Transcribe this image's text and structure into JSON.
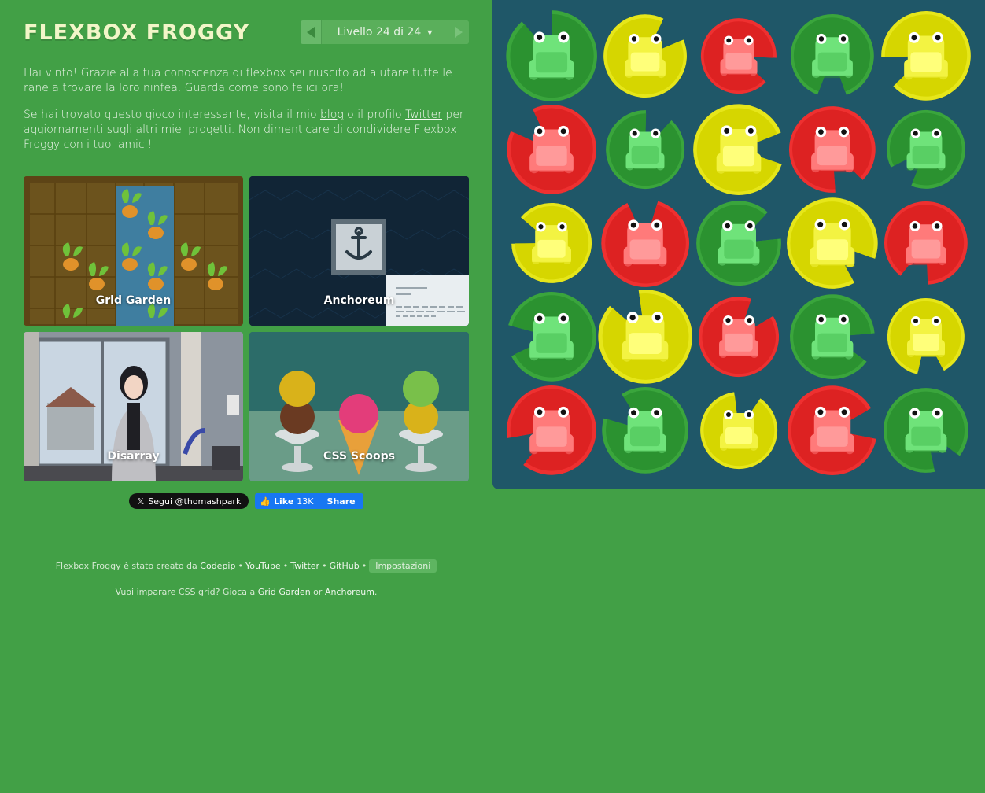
{
  "header": {
    "title": "FLEXBOX FROGGY",
    "level_text": "Livello 24 di 24"
  },
  "intro": {
    "win_text": "Hai vinto! Grazie alla tua conoscenza di flexbox sei riuscito ad aiutare tutte le rane a trovare la loro ninfea. Guarda come sono felici ora!",
    "follow_pre": "Se hai trovato questo gioco interessante, visita il mio ",
    "blog_link": "blog",
    "follow_mid": " o il profilo ",
    "twitter_link": "Twitter",
    "follow_post": " per aggiornamenti sugli altri miei progetti. Non dimenticare di condividere Flexbox Froggy con i tuoi amici!"
  },
  "games": [
    {
      "label": "Grid Garden"
    },
    {
      "label": "Anchoreum"
    },
    {
      "label": "Disarray"
    },
    {
      "label": "CSS Scoops"
    }
  ],
  "social": {
    "tweet_label": "Segui @thomashpark",
    "fb_like": "Like",
    "fb_count": "13K",
    "fb_share": "Share"
  },
  "credits": {
    "created_by": "Flexbox Froggy è stato creato da",
    "codepip": "Codepip",
    "youtube": "YouTube",
    "twitter": "Twitter",
    "github": "GitHub",
    "settings": "Impostazioni",
    "learn_pre": "Vuoi imparare CSS grid? Gioca a",
    "grid_garden": "Grid Garden",
    "or": "or",
    "anchoreum": "Anchoreum",
    "learn_post": "."
  },
  "colors": {
    "background": "#42a046",
    "board": "#1f5768",
    "green_pad": "#2b9230",
    "green_frog": "#6fe37a",
    "yellow_pad": "#d6d600",
    "yellow_frog": "#f3f342",
    "red_pad": "#dd2222",
    "red_frog": "#ff7a7a"
  },
  "board": {
    "rows": [
      [
        "green",
        "yellow",
        "red",
        "green",
        "yellow"
      ],
      [
        "red",
        "green",
        "yellow",
        "red",
        "green"
      ],
      [
        "yellow",
        "red",
        "green",
        "yellow",
        "red"
      ],
      [
        "green",
        "yellow",
        "red",
        "green",
        "yellow"
      ],
      [
        "red",
        "green",
        "yellow",
        "red",
        "green"
      ]
    ]
  }
}
